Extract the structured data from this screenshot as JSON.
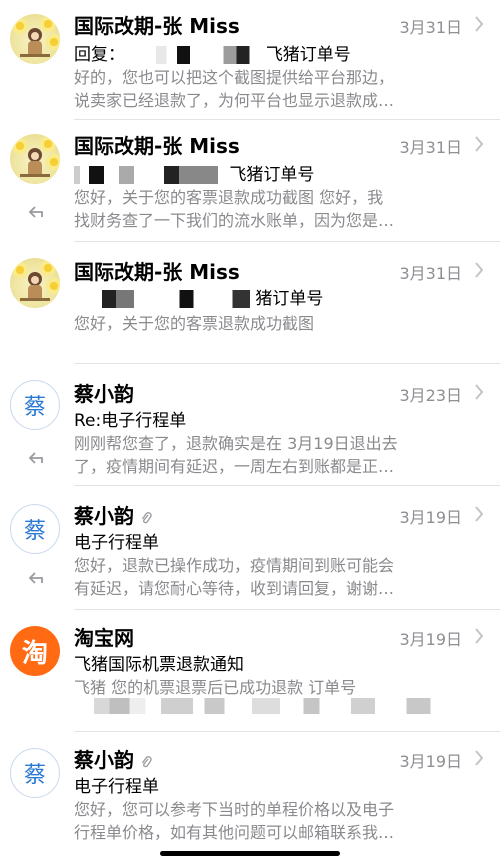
{
  "mails": [
    {
      "sender": "国际改期-张 Miss",
      "date": "3月31日",
      "subject_prefix": "回复：",
      "subject_suffix": "飞猪订单号",
      "preview_line1": "好的，您也可以把这个截图提供给平台那边，",
      "preview_line2": "说卖家已经退款了，为何平台也显示退款成…"
    },
    {
      "sender": "国际改期-张 Miss",
      "date": "3月31日",
      "subject_suffix": "飞猪订单号",
      "preview_line1": "您好，关于您的客票退款成功截图 您好，我",
      "preview_line2": "找财务查了一下我们的流水账单，因为您是…"
    },
    {
      "sender": "国际改期-张 Miss",
      "date": "3月31日",
      "subject_suffix": "猪订单号",
      "preview_line1": "您好，关于您的客票退款成功截图"
    },
    {
      "sender": "蔡小韵",
      "avatar_letter": "蔡",
      "date": "3月23日",
      "subject": "Re:电子行程单",
      "preview_line1": "刚刚帮您查了，退款确实是在 3月19日退出去",
      "preview_line2": "了，疫情期间有延迟，一周左右到账都是正…"
    },
    {
      "sender": "蔡小韵",
      "avatar_letter": "蔡",
      "date": "3月19日",
      "subject": "电子行程单",
      "preview_line1": "您好，退款已操作成功，疫情期间到账可能会",
      "preview_line2": "有延迟，请您耐心等待，收到请回复，谢谢…"
    },
    {
      "sender": "淘宝网",
      "avatar_letter": "淘",
      "date": "3月19日",
      "subject": "飞猪国际机票退款通知",
      "preview_line1": "飞猪 您的机票退票后已成功退款 订单号"
    },
    {
      "sender": "蔡小韵",
      "avatar_letter": "蔡",
      "date": "3月19日",
      "subject": "电子行程单",
      "preview_line1": "您好，您可以参考下当时的单程价格以及电子",
      "preview_line2": "行程单价格，如有其他问题可以邮箱联系我…"
    }
  ],
  "icons": {
    "reply": "reply-arrow-icon",
    "attachment": "paperclip-icon",
    "chevron": "chevron-right-icon"
  },
  "colors": {
    "accent": "#2a78d4",
    "taobao": "#ff6a13",
    "secondary_text": "#8a8a8e",
    "date_text": "#8e8e93"
  }
}
